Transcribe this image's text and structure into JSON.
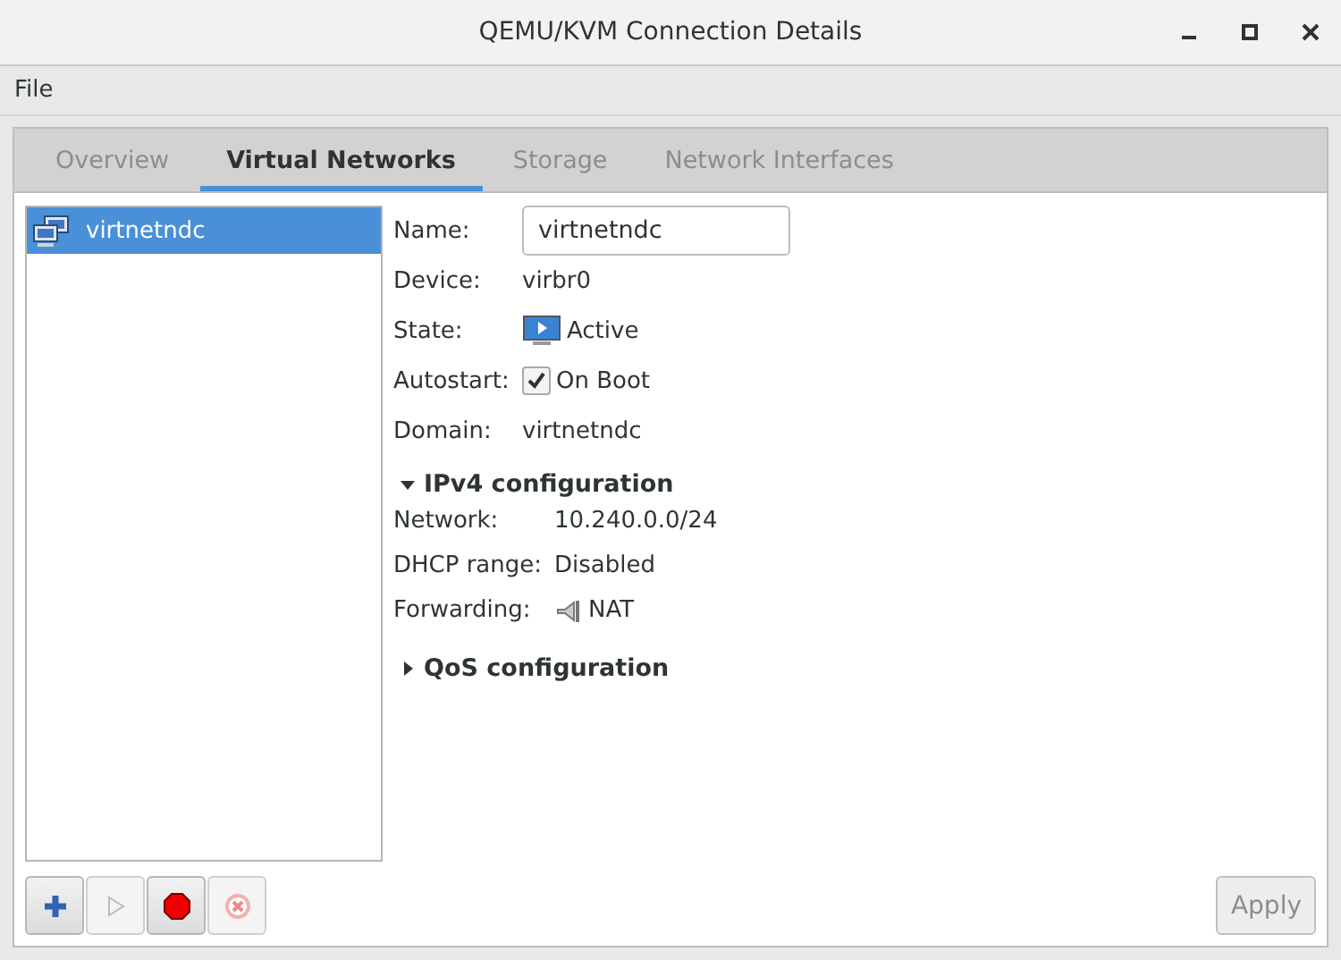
{
  "window": {
    "title": "QEMU/KVM Connection Details"
  },
  "menu": [
    "File"
  ],
  "tabs": [
    {
      "label": "Overview",
      "selected": false
    },
    {
      "label": "Virtual Networks",
      "selected": true
    },
    {
      "label": "Storage",
      "selected": false
    },
    {
      "label": "Network Interfaces",
      "selected": false
    }
  ],
  "networks": [
    {
      "name": "virtnetndc",
      "selected": true
    }
  ],
  "details": {
    "name_label": "Name:",
    "name_value": "virtnetndc",
    "rows": [
      {
        "kind": "text",
        "label": "Device:",
        "value": "virbr0"
      },
      {
        "kind": "state",
        "label": "State:",
        "value": "Active"
      },
      {
        "kind": "check",
        "label": "Autostart:",
        "value": "On Boot",
        "checked": true
      },
      {
        "kind": "text",
        "label": "Domain:",
        "value": "virtnetndc"
      }
    ]
  },
  "sections": [
    {
      "title": "IPv4 configuration",
      "expanded": true,
      "rows": [
        {
          "kind": "text",
          "label": "Network:",
          "value": "10.240.0.0/24"
        },
        {
          "kind": "text",
          "label": "DHCP range:",
          "value": "Disabled"
        },
        {
          "kind": "forward",
          "label": "Forwarding:",
          "value": "NAT"
        }
      ]
    },
    {
      "title": "QoS configuration",
      "expanded": false
    }
  ],
  "toolbar": [
    {
      "kind": "add",
      "disabled": false
    },
    {
      "kind": "start",
      "disabled": true
    },
    {
      "kind": "stop",
      "disabled": false
    },
    {
      "kind": "delete",
      "disabled": true
    }
  ],
  "apply": {
    "label": "Apply",
    "disabled": true
  }
}
